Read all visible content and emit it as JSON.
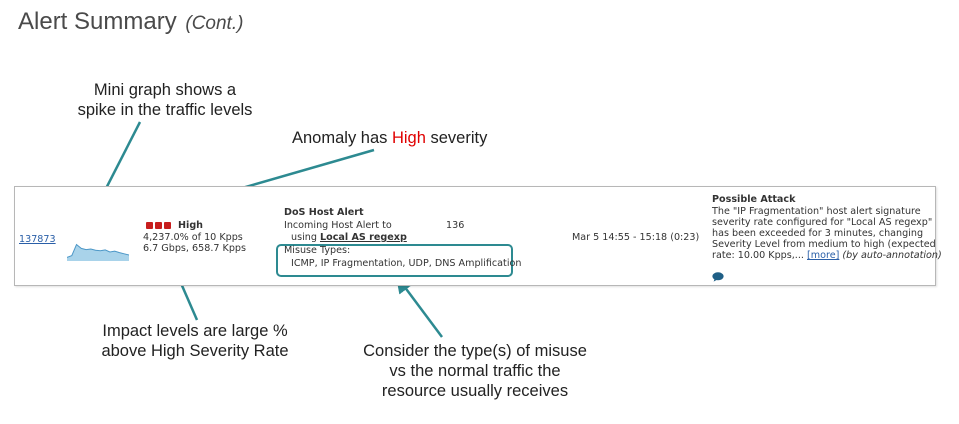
{
  "slide": {
    "title": "Alert Summary",
    "subtitle": "(Cont.)"
  },
  "callouts": {
    "mini_graph": [
      "Mini graph shows a",
      "spike in the traffic levels"
    ],
    "anomaly": {
      "pre": "Anomaly has ",
      "highlight": "High",
      "post": " severity"
    },
    "impact": [
      "Impact levels are large %",
      "above High Severity Rate"
    ],
    "misuse": [
      "Consider the type(s) of misuse",
      "vs the normal traffic the",
      "resource usually receives"
    ]
  },
  "alert": {
    "id": "137873",
    "sparkline": [
      0.12,
      0.18,
      0.55,
      0.42,
      0.38,
      0.4,
      0.36,
      0.34,
      0.37,
      0.3,
      0.33,
      0.28,
      0.24,
      0.2
    ],
    "severity": {
      "label": "High",
      "level": 3
    },
    "impact_line1": "4,237.0% of 10 Kpps",
    "impact_line2": "6.7 Gbps, 658.7 Kpps",
    "type": "DoS Host Alert",
    "desc_line1": "Incoming Host Alert to",
    "desc_count": "136",
    "desc_using": "using",
    "desc_target": "Local AS regexp",
    "misuse_label": "Misuse Types:",
    "misuse_types": "ICMP, IP Fragmentation, UDP, DNS Amplification",
    "time": "Mar 5 14:55 - 15:18 (0:23)",
    "classification_title": "Possible Attack",
    "classification_lines": [
      "The \"IP Fragmentation\" host alert signature",
      "severity rate configured for \"Local AS regexp\"",
      "has been exceeded for 3 minutes, changing",
      "Severity Level from medium to high (expected"
    ],
    "classification_last": "rate: 10.00 Kpps,...",
    "more_link": "[more]",
    "annotation": "(by auto-annotation)",
    "comment_icon": "speech-bubble-icon",
    "colors": {
      "sparkline_fill": "#a9d3ea",
      "sparkline_stroke": "#4c97c7",
      "severity": "#c81e1e",
      "link": "#2a5fa8",
      "box": "#2d8a91",
      "anomaly_highlight": "#e00000",
      "arrow": "#2d8a91"
    }
  }
}
